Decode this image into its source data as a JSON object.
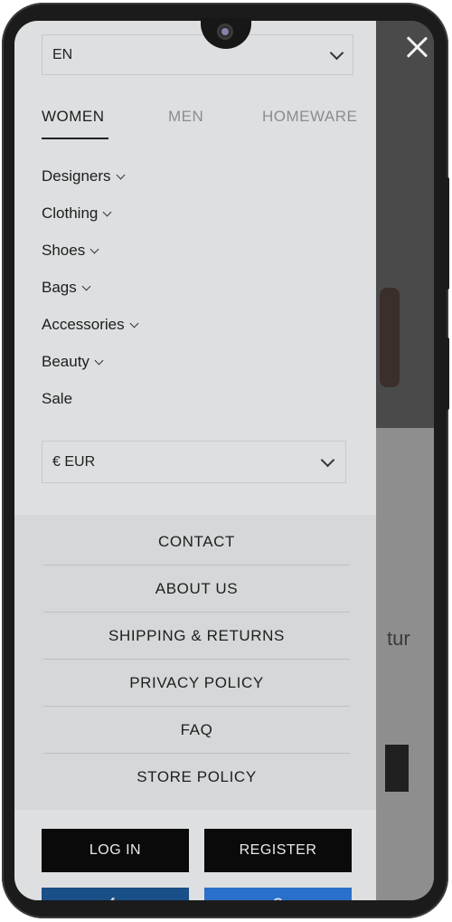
{
  "language": {
    "selected": "EN"
  },
  "tabs": [
    {
      "label": "WOMEN",
      "active": true
    },
    {
      "label": "MEN",
      "active": false
    },
    {
      "label": "HOMEWARE",
      "active": false
    }
  ],
  "categories": [
    {
      "label": "Designers",
      "has_submenu": true
    },
    {
      "label": "Clothing",
      "has_submenu": true
    },
    {
      "label": "Shoes",
      "has_submenu": true
    },
    {
      "label": "Bags",
      "has_submenu": true
    },
    {
      "label": "Accessories",
      "has_submenu": true
    },
    {
      "label": "Beauty",
      "has_submenu": true
    },
    {
      "label": "Sale",
      "has_submenu": false
    }
  ],
  "currency": {
    "selected": "€ EUR"
  },
  "info_links": [
    {
      "label": "CONTACT"
    },
    {
      "label": "ABOUT US"
    },
    {
      "label": "SHIPPING & RETURNS"
    },
    {
      "label": "PRIVACY POLICY"
    },
    {
      "label": "FAQ"
    },
    {
      "label": "STORE POLICY"
    }
  ],
  "auth": {
    "login_label": "LOG IN",
    "register_label": "REGISTER"
  },
  "background": {
    "partial_text": "tur"
  },
  "icons": {
    "close": "close-icon",
    "chevron": "chevron-down-icon",
    "facebook": "facebook-icon",
    "google": "google-icon"
  },
  "colors": {
    "drawer_bg": "#dddfe0",
    "links_bg": "#d5d7d8",
    "button_bg": "#0a0a0a",
    "facebook_blue": "#1a4f88",
    "google_blue": "#2a6fc9"
  }
}
